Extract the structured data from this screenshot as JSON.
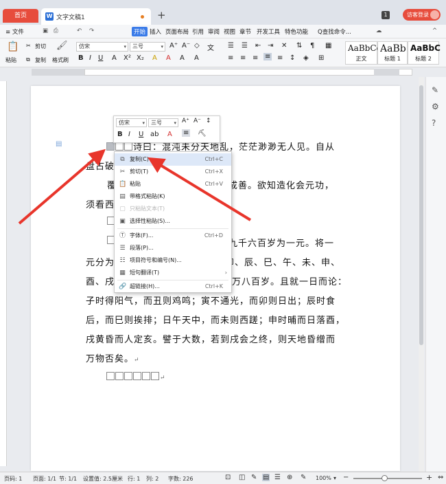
{
  "titlebar": {
    "home_tab": "首页",
    "doc_tab": "文字文稿1",
    "new_tab": "+",
    "badge": "1",
    "login": "访客登录"
  },
  "menubar": {
    "file": "≡ 文件",
    "items": [
      "开始",
      "插入",
      "页面布局",
      "引用",
      "审阅",
      "视图",
      "章节",
      "开发工具",
      "特色功能"
    ],
    "search": "Q查找命令..."
  },
  "ribbon": {
    "paste": "粘贴",
    "cut": "剪切",
    "copy": "复制",
    "format_painter": "格式刷",
    "font": "仿宋",
    "size": "三号",
    "styles": [
      {
        "sample": "AaBbCcI",
        "caption": "正文"
      },
      {
        "sample": "AaBb",
        "caption": "标题 1"
      },
      {
        "sample": "AaBbC",
        "caption": "标题 2"
      }
    ]
  },
  "document": {
    "lines": [
      "诗曰：混沌未分天地乱，茫茫渺渺无人见。自从",
      "盘古破",
      "覆",
      "成善。欲知造化会元功，",
      "须看西",
      "九千六百岁为一元。将一",
      "元分为",
      "卯、辰、巳、午、未、申、",
      "酉、戌",
      "万八百岁。且就一日而论：",
      "子时得阳气，而丑则鸡鸣；寅不通光，而卯则日出；辰时食",
      "后，而巳则挨排；日午天中，而未则西蹉；申时晡而日落酉，",
      "戌黄昏而人定亥。譬于大数，若到戌会之终，则天地昏缯而",
      "万物否矣。"
    ],
    "return_mark": "↵"
  },
  "minitoolbar": {
    "font": "仿宋",
    "size": "三号"
  },
  "context_menu": {
    "items": [
      {
        "label": "复制(C)",
        "shortcut": "Ctrl+C"
      },
      {
        "label": "剪切(T)",
        "shortcut": "Ctrl+X"
      },
      {
        "label": "粘贴",
        "shortcut": "Ctrl+V"
      },
      {
        "label": "带格式粘贴(K)",
        "shortcut": ""
      },
      {
        "label": "只粘贴文本(T)",
        "shortcut": ""
      },
      {
        "label": "选择性粘贴(S)...",
        "shortcut": ""
      },
      {
        "label": "字体(F)...",
        "shortcut": "Ctrl+D"
      },
      {
        "label": "段落(P)...",
        "shortcut": ""
      },
      {
        "label": "项目符号和编号(N)...",
        "shortcut": ""
      },
      {
        "label": "短句翻译(T)",
        "shortcut": ""
      },
      {
        "label": "超链接(H)...",
        "shortcut": "Ctrl+K"
      }
    ]
  },
  "statusbar": {
    "page_num": "页码: 1",
    "page": "页面: 1/1",
    "section": "节: 1/1",
    "setting": "设置值: 2.5厘米",
    "row": "行: 1",
    "col": "列: 2",
    "words": "字数: 226",
    "zoom": "100%",
    "zoom_minus": "−",
    "zoom_plus": "+"
  },
  "colors": {
    "accent": "#3a7be8",
    "home_tab": "#e74c3c",
    "arrow": "#e8352b"
  }
}
